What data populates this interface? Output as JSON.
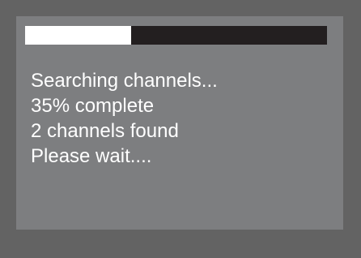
{
  "progress": {
    "percent": 35,
    "fill_color": "#ffffff",
    "track_color": "#231f20"
  },
  "status": {
    "lines": [
      "Searching channels...",
      "35% complete",
      "2 channels found",
      "Please wait...."
    ]
  }
}
